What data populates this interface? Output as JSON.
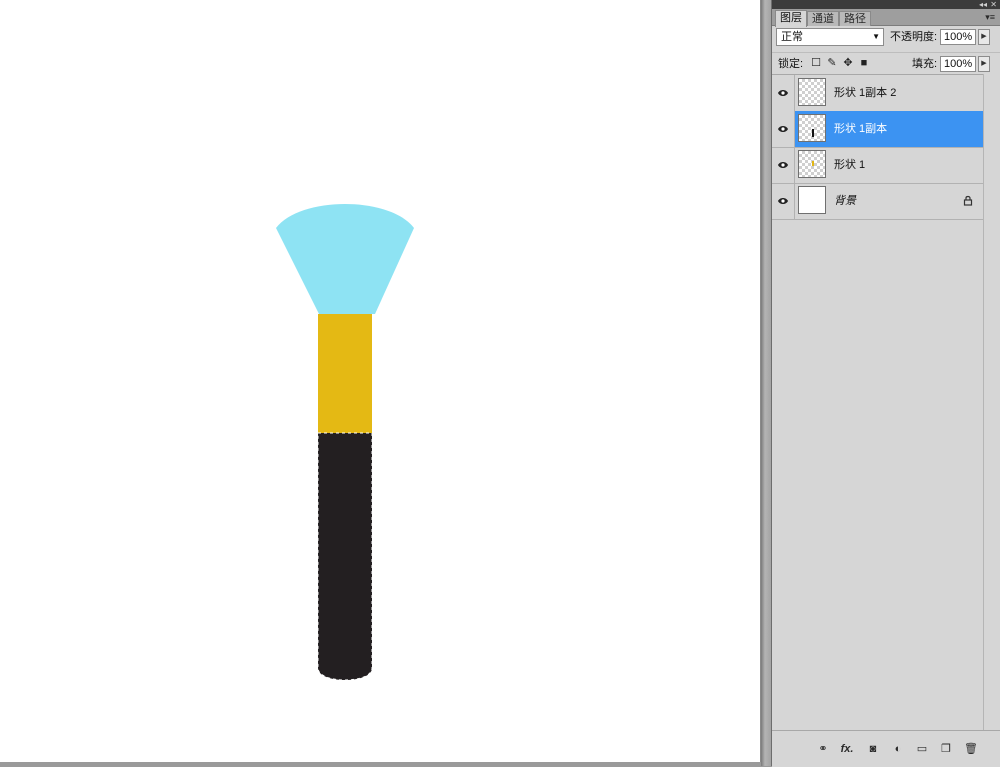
{
  "panel": {
    "collapse_glyph": "◂◂",
    "close_glyph": "✕",
    "menu_glyph": "▾≡",
    "tabs": [
      {
        "label": "图层",
        "active": true
      },
      {
        "label": "通道",
        "active": false
      },
      {
        "label": "路径",
        "active": false
      }
    ],
    "blend_mode": "正常",
    "opacity_label": "不透明度:",
    "opacity_value": "100%",
    "lock_label": "锁定:",
    "lock_icons": [
      "lock-transparent-pixels-icon",
      "lock-image-pixels-icon",
      "lock-position-icon",
      "lock-all-icon"
    ],
    "fill_label": "填充:",
    "fill_value": "100%",
    "layers": [
      {
        "name": "形状 1副本 2",
        "selected": false,
        "thumb": "transparent"
      },
      {
        "name": "形状 1副本",
        "selected": true,
        "thumb": "transparent-with-dark-mark"
      },
      {
        "name": "形状 1",
        "selected": false,
        "thumb": "transparent-with-gold-mark"
      },
      {
        "name": "背景",
        "selected": false,
        "thumb": "white",
        "locked": true
      }
    ],
    "bottom_icons": [
      "link-layers-icon",
      "fx-icon",
      "add-mask-icon",
      "adjustment-layer-icon",
      "new-group-icon",
      "new-layer-icon",
      "trash-icon"
    ]
  },
  "canvas": {
    "background": "#ffffff",
    "brush": {
      "head_color": "#8ee3f3",
      "ferrule_color": "#e4b914",
      "handle_color": "#231f21"
    }
  }
}
